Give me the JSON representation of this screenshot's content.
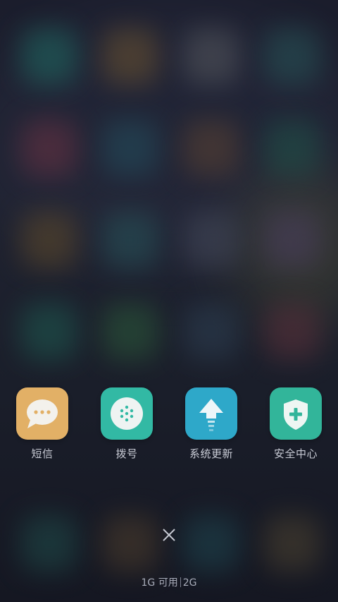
{
  "apps": [
    {
      "label": "短信",
      "icon": "message-icon",
      "color": "#e2b066"
    },
    {
      "label": "拨号",
      "icon": "dialpad-icon",
      "color": "#32b9a4"
    },
    {
      "label": "系统更新",
      "icon": "update-arrow-icon",
      "color": "#2ea8c9"
    },
    {
      "label": "安全中心",
      "icon": "shield-plus-icon",
      "color": "#32b59a"
    }
  ],
  "close": {
    "icon": "close-icon"
  },
  "memory": {
    "available": "1G 可用",
    "total": "2G"
  },
  "colors": {
    "background": "#181a26",
    "label_text": "#c9ccd6",
    "memory_text": "#a9adba"
  }
}
